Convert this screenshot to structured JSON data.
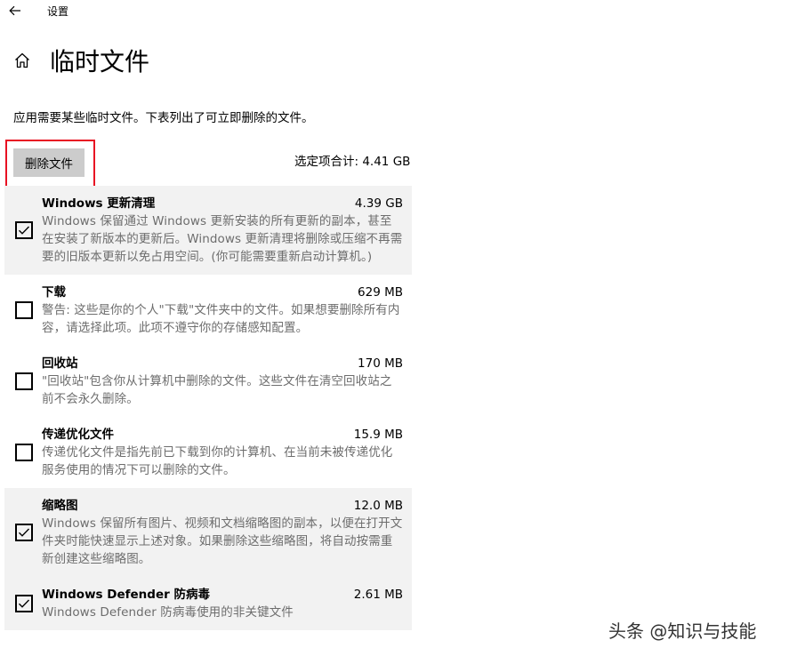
{
  "titlebar": {
    "back_icon": "arrow-left-icon",
    "app_title": "设置"
  },
  "header": {
    "home_icon": "home-icon",
    "title": "临时文件"
  },
  "description": "应用需要某些临时文件。下表列出了可立即删除的文件。",
  "actions": {
    "delete_label": "删除文件",
    "total_text": "选定项合计: 4.41 GB",
    "highlight_color": "#e81123"
  },
  "files": [
    {
      "name": "Windows 更新清理",
      "size": "4.39 GB",
      "checked": true,
      "description": "Windows 保留通过 Windows 更新安装的所有更新的副本，甚至在安装了新版本的更新后。Windows 更新清理将删除或压缩不再需要的旧版本更新以免占用空间。(你可能需要重新启动计算机。)"
    },
    {
      "name": "下载",
      "size": "629 MB",
      "checked": false,
      "description": "警告: 这些是你的个人\"下载\"文件夹中的文件。如果想要删除所有内容，请选择此项。此项不遵守你的存储感知配置。"
    },
    {
      "name": "回收站",
      "size": "170 MB",
      "checked": false,
      "description": "\"回收站\"包含你从计算机中删除的文件。这些文件在清空回收站之前不会永久删除。"
    },
    {
      "name": "传递优化文件",
      "size": "15.9 MB",
      "checked": false,
      "description": "传递优化文件是指先前已下载到你的计算机、在当前未被传递优化服务使用的情况下可以删除的文件。"
    },
    {
      "name": "缩略图",
      "size": "12.0 MB",
      "checked": true,
      "description": "Windows 保留所有图片、视频和文档缩略图的副本，以便在打开文件夹时能快速显示上述对象。如果删除这些缩略图，将自动按需重新创建这些缩略图。"
    },
    {
      "name": "Windows Defender 防病毒",
      "size": "2.61 MB",
      "checked": true,
      "description": "Windows Defender 防病毒使用的非关键文件"
    }
  ],
  "watermark": "头条 @知识与技能"
}
